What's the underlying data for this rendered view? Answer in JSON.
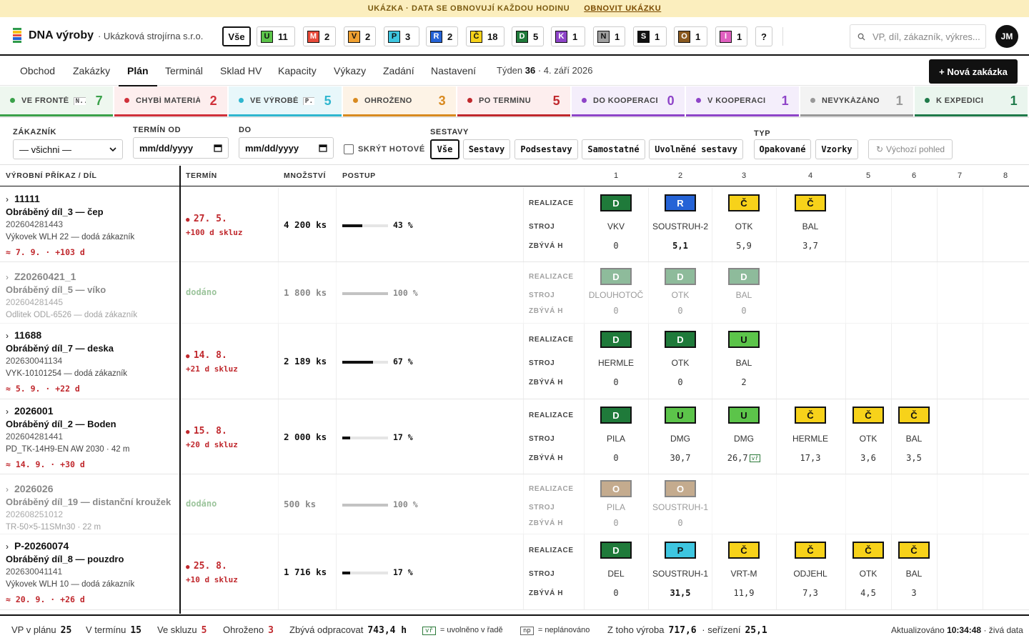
{
  "banner": {
    "text": "UKÁZKA · DATA SE OBNOVUJÍ KAŽDOU HODINU",
    "link": "OBNOVIT UKÁZKU"
  },
  "app": {
    "brand": "DNA výroby",
    "company": "· Ukázková strojírna s.r.o."
  },
  "filter_chips": [
    {
      "code": "Vše",
      "count": ""
    },
    {
      "code": "U",
      "count": "11",
      "color": "#5cc44a"
    },
    {
      "code": "M",
      "count": "2",
      "color": "#e84a3a"
    },
    {
      "code": "V",
      "count": "2",
      "color": "#f0a030"
    },
    {
      "code": "P",
      "count": "3",
      "color": "#3ec6e0"
    },
    {
      "code": "R",
      "count": "2",
      "color": "#2563d6"
    },
    {
      "code": "Č",
      "count": "18",
      "color": "#f7d21a"
    },
    {
      "code": "D",
      "count": "5",
      "color": "#1f7a3a"
    },
    {
      "code": "K",
      "count": "1",
      "color": "#8e44c8"
    },
    {
      "code": "N",
      "count": "1",
      "color": "#a0a0a0"
    },
    {
      "code": "S",
      "count": "1",
      "color": "#111111"
    },
    {
      "code": "O",
      "count": "1",
      "color": "#8a5a20"
    },
    {
      "code": "I",
      "count": "1",
      "color": "#e060c0"
    },
    {
      "code": "?",
      "count": ""
    }
  ],
  "search": {
    "placeholder": "VP, díl, zákazník, výkres..."
  },
  "user": {
    "initials": "JM"
  },
  "nav": {
    "items": [
      "Obchod",
      "Zakázky",
      "Plán",
      "Terminál",
      "Sklad HV",
      "Kapacity",
      "Výkazy",
      "Zadání",
      "Nastavení"
    ],
    "active": "Plán",
    "week_label": "Týden",
    "week_num": "36",
    "week_date": "· 4. září 2026",
    "new_button": "+ Nová zakázka"
  },
  "status_tiles": [
    {
      "label": "VE FRONTĚ",
      "chip": "N...",
      "count": "7",
      "color": "#3aa14a",
      "bg": "#eef7ef"
    },
    {
      "label": "CHYBÍ MATERIÁL",
      "count": "2",
      "color": "#d0303a",
      "bg": "#fdeeee"
    },
    {
      "label": "VE VÝROBĚ",
      "chip": "P...",
      "count": "5",
      "color": "#2fb6cf",
      "bg": "#e8f7fa"
    },
    {
      "label": "OHROŽENO",
      "count": "3",
      "color": "#d88a20",
      "bg": "#fdf3e6"
    },
    {
      "label": "PO TERMÍNU",
      "count": "5",
      "color": "#c0282d",
      "bg": "#fdeeee"
    },
    {
      "label": "DO KOOPERACE",
      "count": "0",
      "color": "#8e44c8",
      "bg": "#f4eefb"
    },
    {
      "label": "V KOOPERACI",
      "count": "1",
      "color": "#8e44c8",
      "bg": "#f4eefb"
    },
    {
      "label": "NEVYKÁZÁNO",
      "count": "1",
      "color": "#999999",
      "bg": "#f3f3f3"
    },
    {
      "label": "K EXPEDICI",
      "count": "1",
      "color": "#1f7a4a",
      "bg": "#eaf5ee"
    }
  ],
  "filters": {
    "customer_label": "ZÁKAZNÍK",
    "customer_value": "— všichni —",
    "from_label": "TERMÍN OD",
    "from_value": "mm/dd/yyyy",
    "to_label": "DO",
    "to_value": "mm/dd/yyyy",
    "hide_done": "SKRÝT HOTOVÉ",
    "assemblies_label": "SESTAVY",
    "assemblies": [
      "Vše",
      "Sestavy",
      "Podsestavy",
      "Samostatné",
      "Uvolněné sestavy"
    ],
    "type_label": "TYP",
    "types": [
      "Opakované",
      "Vzorky"
    ],
    "reset": "Výchozí pohled"
  },
  "table": {
    "headers": [
      "VÝROBNÍ PŘÍKAZ / DÍL",
      "TERMÍN",
      "MNOŽSTVÍ",
      "POSTUP"
    ],
    "op_numbers": [
      "1",
      "2",
      "3",
      "4",
      "5",
      "6",
      "7",
      "8"
    ],
    "row_labels": [
      "REALIZACE",
      "STROJ",
      "ZBÝVÁ H"
    ],
    "rows": [
      {
        "id": "11111",
        "part": "Obráběný díl_3 — čep",
        "num": "202604281443",
        "src": "Výkovek WLH 22 — dodá zákazník",
        "delay": "≈ 7. 9. · +103 d",
        "term": "27. 5.",
        "slip": "+100 d skluz",
        "qty": "4 200 ks",
        "progress": 0.43,
        "pct": "43 %",
        "done": false,
        "ops": [
          {
            "c": "D",
            "m": "VKV",
            "h": "0"
          },
          {
            "c": "R",
            "m": "SOUSTRUH-2",
            "h": "5,1",
            "b": true
          },
          {
            "c": "Č",
            "m": "OTK",
            "h": "5,9"
          },
          {
            "c": "Č",
            "m": "BAL",
            "h": "3,7"
          }
        ]
      },
      {
        "id": "Z20260421_1",
        "part": "Obráběný díl_5 — víko",
        "num": "202604281445",
        "src": "Odlitek ODL-6526 — dodá zákazník",
        "delay": "",
        "term": "dodáno",
        "slip": "",
        "qty": "1 800 ks",
        "progress": 1,
        "pct": "100 %",
        "done": true,
        "ops": [
          {
            "c": "D",
            "m": "DLOUHOTOČ",
            "h": "0"
          },
          {
            "c": "D",
            "m": "OTK",
            "h": "0"
          },
          {
            "c": "D",
            "m": "BAL",
            "h": "0"
          }
        ]
      },
      {
        "id": "11688",
        "part": "Obráběný díl_7 — deska",
        "num": "202630041134",
        "src": "VYK-10101254 — dodá zákazník",
        "delay": "≈ 5. 9. · +22 d",
        "term": "14. 8.",
        "slip": "+21 d skluz",
        "qty": "2 189 ks",
        "progress": 0.67,
        "pct": "67 %",
        "done": false,
        "ops": [
          {
            "c": "D",
            "m": "HERMLE",
            "h": "0"
          },
          {
            "c": "D",
            "m": "OTK",
            "h": "0"
          },
          {
            "c": "U",
            "m": "BAL",
            "h": "2"
          }
        ]
      },
      {
        "id": "2026001",
        "part": "Obráběný díl_2 — Boden",
        "num": "202604281441",
        "src": "PD_TK-14H9-EN AW 2030 · 42 m",
        "delay": "≈ 14. 9. · +30 d",
        "term": "15. 8.",
        "slip": "+20 d skluz",
        "qty": "2 000 ks",
        "progress": 0.17,
        "pct": "17 %",
        "done": false,
        "ops": [
          {
            "c": "D",
            "m": "PILA",
            "h": "0"
          },
          {
            "c": "U",
            "m": "DMG",
            "h": "30,7"
          },
          {
            "c": "U",
            "m": "DMG",
            "h": "26,7",
            "vr": "vř"
          },
          {
            "c": "Č",
            "m": "HERMLE",
            "h": "17,3"
          },
          {
            "c": "Č",
            "m": "OTK",
            "h": "3,6"
          },
          {
            "c": "Č",
            "m": "BAL",
            "h": "3,5"
          }
        ]
      },
      {
        "id": "2026026",
        "part": "Obráběný díl_19 — distanční kroužek",
        "num": "202608251012",
        "src": "TR-50×5-11SMn30 · 22 m",
        "delay": "",
        "term": "dodáno",
        "slip": "",
        "qty": "500 ks",
        "progress": 1,
        "pct": "100 %",
        "done": true,
        "ops": [
          {
            "c": "O",
            "m": "PILA",
            "h": "0"
          },
          {
            "c": "O",
            "m": "SOUSTRUH-1",
            "h": "0"
          }
        ]
      },
      {
        "id": "P-20260074",
        "part": "Obráběný díl_8 — pouzdro",
        "num": "202630041141",
        "src": "Výkovek WLH 10 — dodá zákazník",
        "delay": "≈ 20. 9. · +26 d",
        "term": "25. 8.",
        "slip": "+10 d skluz",
        "qty": "1 716 ks",
        "progress": 0.17,
        "pct": "17 %",
        "done": false,
        "ops": [
          {
            "c": "D",
            "m": "DEL",
            "h": "0"
          },
          {
            "c": "P",
            "m": "SOUSTRUH-1",
            "h": "31,5",
            "b": true
          },
          {
            "c": "Č",
            "m": "VRT-M",
            "h": "11,9"
          },
          {
            "c": "Č",
            "m": "ODJEHL",
            "h": "7,3"
          },
          {
            "c": "Č",
            "m": "OTK",
            "h": "4,5"
          },
          {
            "c": "Č",
            "m": "BAL",
            "h": "3"
          }
        ]
      }
    ]
  },
  "op_colors": {
    "D": "#1f7a3a",
    "R": "#2563d6",
    "Č": "#f7d21a",
    "U": "#5cc44a",
    "P": "#3ec6e0",
    "O": "#8a5a20"
  },
  "footer": {
    "vp_label": "VP v plánu",
    "vp": "25",
    "term_label": "V termínu",
    "term": "15",
    "slip_label": "Ve skluzu",
    "slip": "5",
    "risk_label": "Ohroženo",
    "risk": "3",
    "remain_label": "Zbývá odpracovat",
    "remain": "743,4 h",
    "vr_tag": "vř",
    "vr_text": "= uvolněno v řadě",
    "np_tag": "np",
    "np_text": "= neplánováno",
    "prod_label": "Z toho výroba",
    "prod": "717,6",
    "setup_label": "· seřízení",
    "setup": "25,1",
    "updated_label": "Aktualizováno",
    "updated": "10:34:48",
    "live": "· živá data"
  }
}
